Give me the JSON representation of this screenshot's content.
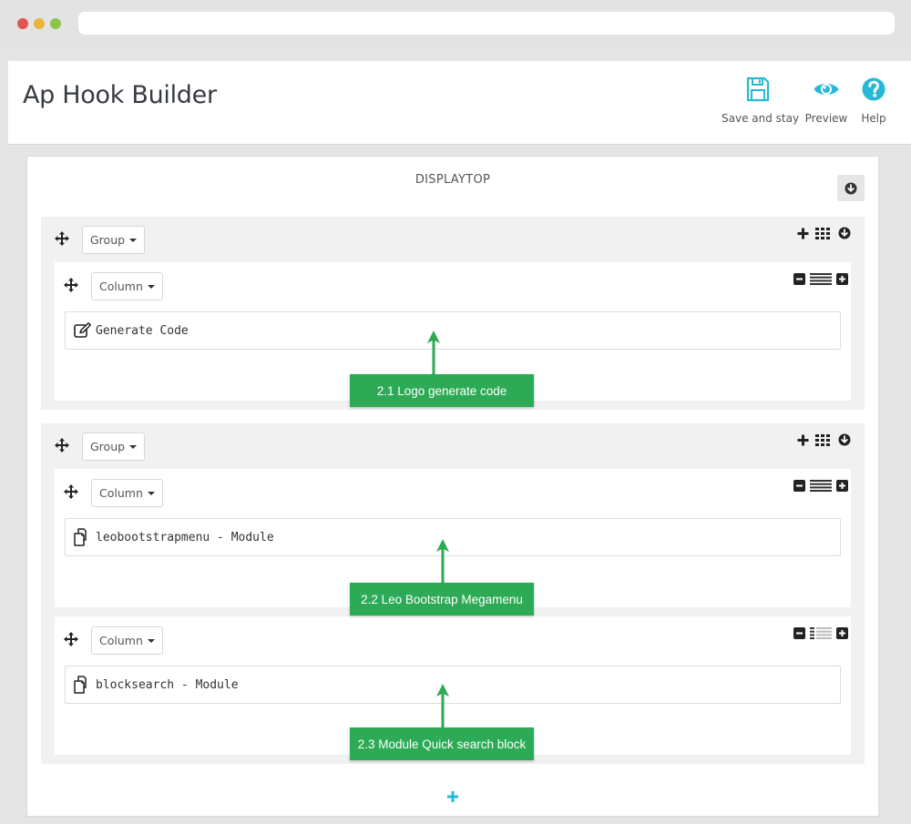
{
  "page": {
    "title": "Ap Hook Builder"
  },
  "toolbar": {
    "save_label": "Save and stay",
    "preview_label": "Preview",
    "help_label": "Help",
    "icon_color": "#25b9d7"
  },
  "hook": {
    "title": "DISPLAYTOP"
  },
  "groups": [
    {
      "dropdown_label": "Group",
      "columns": [
        {
          "dropdown_label": "Column",
          "module_icon": "edit-icon",
          "module_label": "Generate Code"
        }
      ]
    },
    {
      "dropdown_label": "Group",
      "columns": [
        {
          "dropdown_label": "Column",
          "module_icon": "copy-icon",
          "module_label": "leobootstrapmenu - Module"
        },
        {
          "dropdown_label": "Column",
          "module_icon": "copy-icon",
          "module_label": "blocksearch - Module"
        }
      ]
    }
  ],
  "annotations": [
    {
      "label": "2.1 Logo generate code"
    },
    {
      "label": "2.2 Leo Bootstrap Megamenu"
    },
    {
      "label": "2.3 Module Quick search block"
    }
  ],
  "colors": {
    "annotation": "#2daa55",
    "accent": "#25b9d7",
    "group_bg": "#f1f1f1"
  }
}
